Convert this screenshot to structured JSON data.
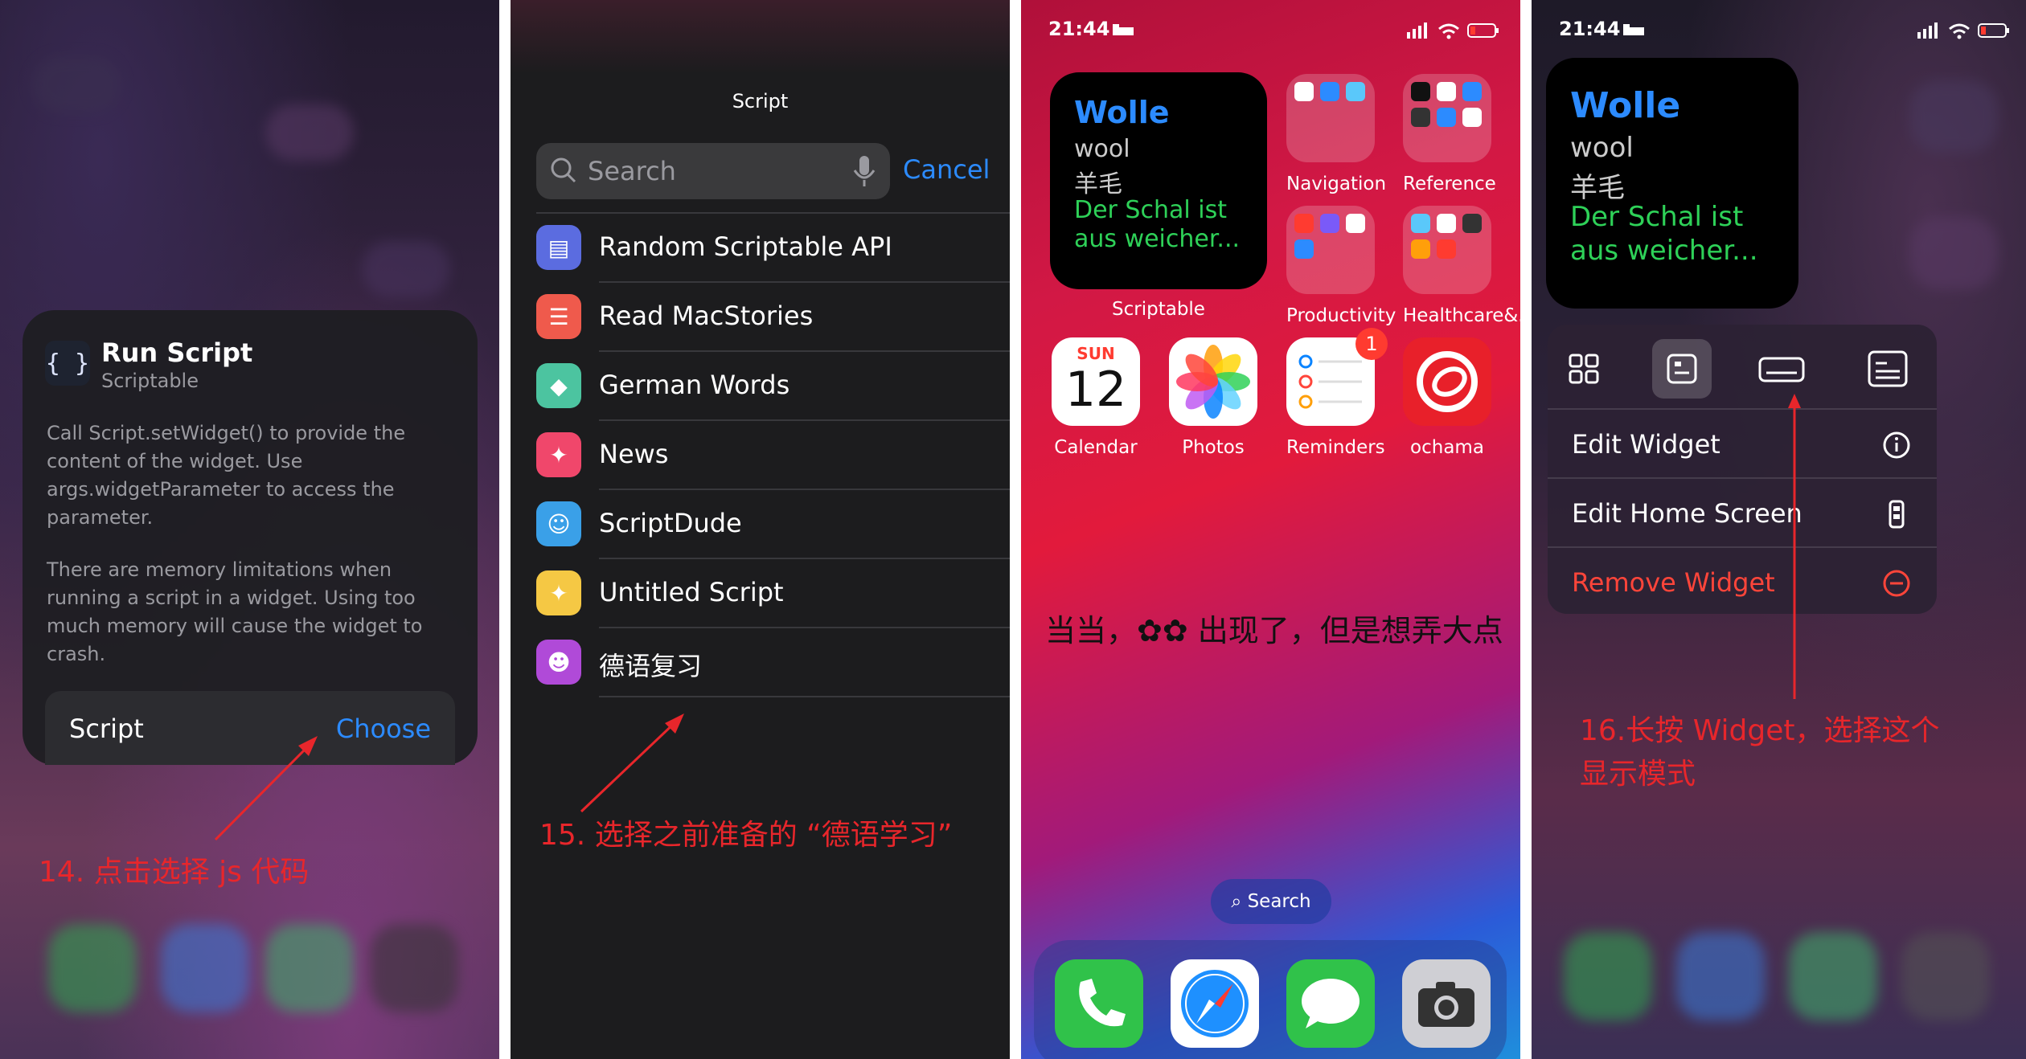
{
  "panel1": {
    "card_title": "Run Script",
    "card_subtitle": "Scriptable",
    "icon_glyph": "{ }",
    "desc1": [
      "Call Script.setWidget() to provide the",
      "content of the widget. Use",
      "args.widgetParameter to access the",
      "parameter."
    ],
    "desc2": [
      "There are memory limitations when",
      "running a script in a widget. Using too",
      "much memory will cause the widget to",
      "crash."
    ],
    "script_label": "Script",
    "choose_label": "Choose",
    "annotation": "14. 点击选择 js 代码"
  },
  "panel2": {
    "title": "Script",
    "search_placeholder": "Search",
    "cancel": "Cancel",
    "items": [
      {
        "label": "Random Scriptable API",
        "color": "#5b6ce0",
        "icon": "book-icon"
      },
      {
        "label": "Read MacStories",
        "color": "#ef5a4c",
        "icon": "newspaper-icon"
      },
      {
        "label": "German Words",
        "color": "#4cc4a0",
        "icon": "graduation-cap-icon"
      },
      {
        "label": "News",
        "color": "#f0476b",
        "icon": "magic-wand-icon"
      },
      {
        "label": "ScriptDude",
        "color": "#3aa0e8",
        "icon": "robot-icon"
      },
      {
        "label": "Untitled Script",
        "color": "#f5c844",
        "icon": "magic-wand-icon"
      },
      {
        "label": "德语复习",
        "color": "#b04ad8",
        "icon": "smile-icon"
      }
    ],
    "annotation": "15. 选择之前准备的 “德语学习”"
  },
  "panel3": {
    "time": "21:44",
    "widget": {
      "word": "Wolle",
      "en": "wool",
      "zh": "羊毛",
      "ex1": "Der Schal ist",
      "ex2": "aus weicher..."
    },
    "widget_label": "Scriptable",
    "folders": [
      "Navigation",
      "Reference",
      "Productivity",
      "Healthcare&..."
    ],
    "apps": [
      {
        "label": "Calendar"
      },
      {
        "label": "Photos"
      },
      {
        "label": "Reminders",
        "badge": "1"
      },
      {
        "label": "ochama"
      }
    ],
    "calendar_day": "SUN",
    "calendar_date": "12",
    "caption": "当当，✿✿ 出现了，但是想弄大点",
    "search_pill": "Search"
  },
  "panel4": {
    "time": "21:44",
    "widget": {
      "word": "Wolle",
      "en": "wool",
      "zh": "羊毛",
      "ex1": "Der Schal ist",
      "ex2": "aus weicher..."
    },
    "menu": [
      {
        "label": "Edit Widget",
        "color": "#ffffff",
        "icon": "info-icon"
      },
      {
        "label": "Edit Home Screen",
        "color": "#ffffff",
        "icon": "phone-icon"
      },
      {
        "label": "Remove Widget",
        "color": "#ff453a",
        "icon": "minus-circle-icon"
      }
    ],
    "annotation1": "16.长按 Widget，选择这个",
    "annotation2": "显示模式"
  }
}
